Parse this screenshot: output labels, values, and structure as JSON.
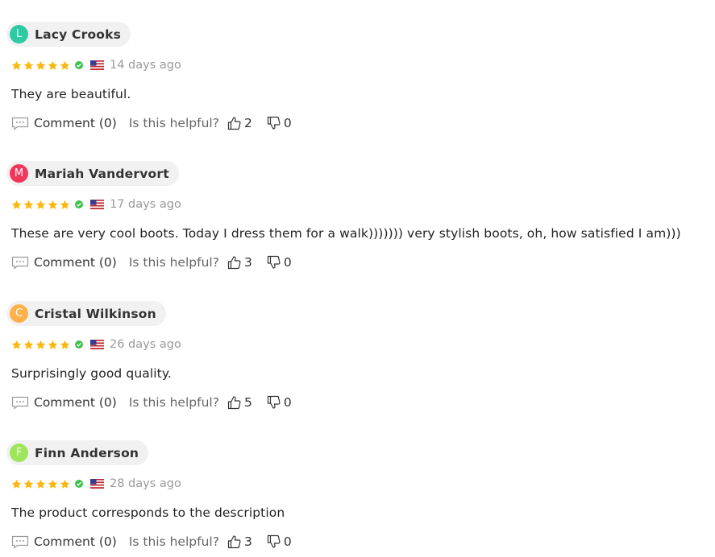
{
  "reviews": [
    {
      "avatar_letter": "L",
      "avatar_color": "#2fc9a4",
      "author": "Lacy Crooks",
      "rating": 5,
      "verified": true,
      "country": "us-flag-icon",
      "date": "14 days ago",
      "text": "They are beautiful.",
      "comment_label": "Comment (0)",
      "helpful_label": "Is this helpful?",
      "helpful_yes": "2",
      "helpful_no": "0"
    },
    {
      "avatar_letter": "M",
      "avatar_color": "#f2355b",
      "author": "Mariah Vandervort",
      "rating": 5,
      "verified": true,
      "country": "us-flag-icon",
      "date": "17 days ago",
      "text": "These are very cool boots. Today I dress them for a walk))))))) very stylish boots, oh, how satisfied I am)))",
      "comment_label": "Comment (0)",
      "helpful_label": "Is this helpful?",
      "helpful_yes": "3",
      "helpful_no": "0"
    },
    {
      "avatar_letter": "C",
      "avatar_color": "#ffb14a",
      "author": "Cristal Wilkinson",
      "rating": 5,
      "verified": true,
      "country": "us-flag-icon",
      "date": "26 days ago",
      "text": "Surprisingly good quality.",
      "comment_label": "Comment (0)",
      "helpful_label": "Is this helpful?",
      "helpful_yes": "5",
      "helpful_no": "0"
    },
    {
      "avatar_letter": "F",
      "avatar_color": "#9ee55b",
      "author": "Finn Anderson",
      "rating": 5,
      "verified": true,
      "country": "us-flag-icon",
      "date": "28 days ago",
      "text": "The product corresponds to the description",
      "comment_label": "Comment (0)",
      "helpful_label": "Is this helpful?",
      "helpful_yes": "3",
      "helpful_no": "0"
    }
  ],
  "colors": {
    "star": "#f9b70f",
    "verified": "#3cc24b",
    "pill_bg": "#f1f1f1",
    "muted_text": "#999999"
  }
}
